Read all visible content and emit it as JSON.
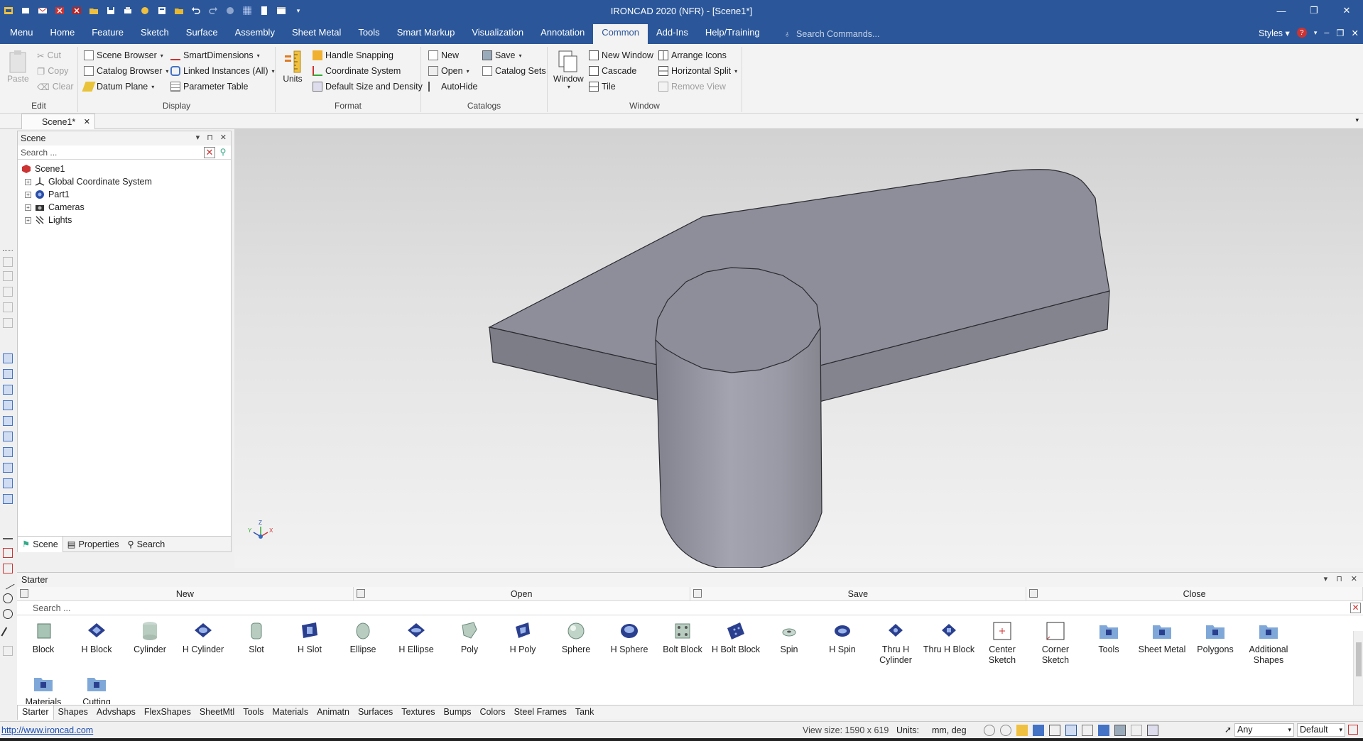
{
  "app": {
    "title": "IRONCAD 2020 (NFR) - [Scene1*]"
  },
  "menu": {
    "tabs": [
      "Menu",
      "Home",
      "Feature",
      "Sketch",
      "Surface",
      "Assembly",
      "Sheet Metal",
      "Tools",
      "Smart Markup",
      "Visualization",
      "Annotation",
      "Common",
      "Add-Ins",
      "Help/Training"
    ],
    "active_tab": "Common",
    "search_placeholder": "Search Commands...",
    "styles_label": "Styles"
  },
  "ribbon": {
    "edit": {
      "name": "Edit",
      "paste": "Paste",
      "cut": "Cut",
      "copy": "Copy",
      "clear": "Clear"
    },
    "display": {
      "name": "Display",
      "scene_browser": "Scene Browser",
      "catalog_browser": "Catalog Browser",
      "datum_plane": "Datum Plane",
      "smart_dimensions": "SmartDimensions",
      "linked_instances": "Linked Instances (All)",
      "parameter_table": "Parameter Table"
    },
    "format": {
      "name": "Format",
      "units": "Units",
      "handle_snapping": "Handle Snapping",
      "coordinate_system": "Coordinate System",
      "default_size": "Default Size and Density"
    },
    "catalogs": {
      "name": "Catalogs",
      "new": "New",
      "open": "Open",
      "autohide": "AutoHide",
      "save": "Save",
      "catalog_sets": "Catalog Sets"
    },
    "window": {
      "name": "Window",
      "window": "Window",
      "new_window": "New Window",
      "cascade": "Cascade",
      "tile": "Tile",
      "arrange_icons": "Arrange Icons",
      "horizontal_split": "Horizontal Split",
      "remove_view": "Remove View"
    }
  },
  "doc_tab": {
    "label": "Scene1*"
  },
  "scene_panel": {
    "title": "Scene",
    "search_placeholder": "Search ...",
    "tree": [
      {
        "label": "Scene1",
        "icon": "scene-icon"
      },
      {
        "label": "Global Coordinate System",
        "icon": "axes-icon"
      },
      {
        "label": "Part1",
        "icon": "part-icon"
      },
      {
        "label": "Cameras",
        "icon": "camera-icon"
      },
      {
        "label": "Lights",
        "icon": "light-icon"
      }
    ],
    "tabs": [
      "Scene",
      "Properties",
      "Search"
    ]
  },
  "viewport": {
    "triad": {
      "x": "X",
      "y": "Y",
      "z": "Z"
    }
  },
  "catalog": {
    "title": "Starter",
    "buttons": [
      "New",
      "Open",
      "Save",
      "Close"
    ],
    "search_placeholder": "Search ...",
    "items": [
      "Block",
      "H Block",
      "Cylinder",
      "H Cylinder",
      "Slot",
      "H Slot",
      "Ellipse",
      "H Ellipse",
      "Poly",
      "H Poly",
      "Sphere",
      "H Sphere",
      "Bolt Block",
      "H Bolt Block",
      "Spin",
      "H Spin",
      "Thru H Cylinder",
      "Thru H Block",
      "Center Sketch",
      "Corner Sketch",
      "Tools",
      "Sheet Metal",
      "Polygons",
      "Additional Shapes"
    ],
    "row2_items": [
      "Materials",
      "Cutting"
    ],
    "tabs": [
      "Starter",
      "Shapes",
      "Advshaps",
      "FlexShapes",
      "SheetMtl",
      "Tools",
      "Materials",
      "Animatn",
      "Surfaces",
      "Textures",
      "Bumps",
      "Colors",
      "Steel Frames",
      "Tank"
    ]
  },
  "status": {
    "url": "http://www.ironcad.com",
    "view_size": "View size: 1590 x 619",
    "units_label": "Units:",
    "units_value": "mm, deg",
    "filter_value": "Any",
    "style_value": "Default"
  },
  "colors": {
    "titlebar": "#2b579a",
    "part_gray": "#8e8e9a",
    "accent": "#2b579a"
  }
}
